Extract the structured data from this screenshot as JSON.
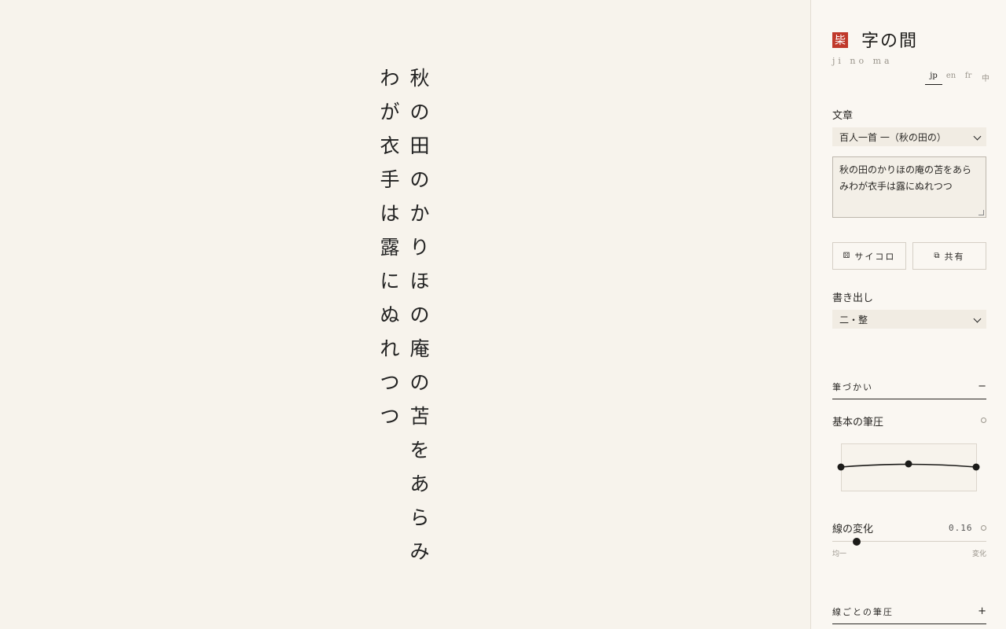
{
  "poem": {
    "columns": [
      [
        "秋",
        "の",
        "田",
        "の",
        "か",
        "り",
        "ほ",
        "の",
        "庵",
        "の",
        "苫",
        "を",
        "あ",
        "ら",
        "み"
      ],
      [
        "わ",
        "が",
        "衣",
        "手",
        "は",
        "露",
        "に",
        "ぬ",
        "れ",
        "つ",
        "つ"
      ]
    ]
  },
  "sidebar": {
    "seal": "枈",
    "title": "字の間",
    "romaji": "ji no ma",
    "languages": [
      {
        "label": "jp",
        "active": true
      },
      {
        "label": "en",
        "active": false
      },
      {
        "label": "fr",
        "active": false
      },
      {
        "label": "中",
        "active": false
      }
    ],
    "text_section": {
      "label": "文章",
      "selected": "百人一首 一（秋の田の）",
      "textarea_value": "秋の田のかりほの庵の苫をあらみわが衣手は露にぬれつつ"
    },
    "buttons": {
      "dice": {
        "icon": "⚄",
        "label": "サイコロ"
      },
      "share": {
        "icon": "⧉",
        "label": "共有"
      }
    },
    "start_section": {
      "label": "書き出し",
      "selected": "二・整"
    },
    "brush_accordion": {
      "label": "筆づかい",
      "sign": "−"
    },
    "base_pressure": {
      "label": "基本の筆圧",
      "curve_points": [
        0.5,
        0.6,
        0.5
      ]
    },
    "line_variation": {
      "label": "線の変化",
      "value": "0.16",
      "fraction": 0.16,
      "min_label": "均一",
      "max_label": "変化"
    },
    "per_stroke_accordion": {
      "label": "線ごとの筆圧",
      "sign": "+"
    }
  },
  "colors": {
    "seal": "#c0392b",
    "background": "#f7f3ec",
    "ink": "#1c1b19"
  },
  "icons": {
    "dice": "dice-icon",
    "share": "copy-icon",
    "select": "chevron-down-icon",
    "reset": "reset-circle-icon"
  }
}
